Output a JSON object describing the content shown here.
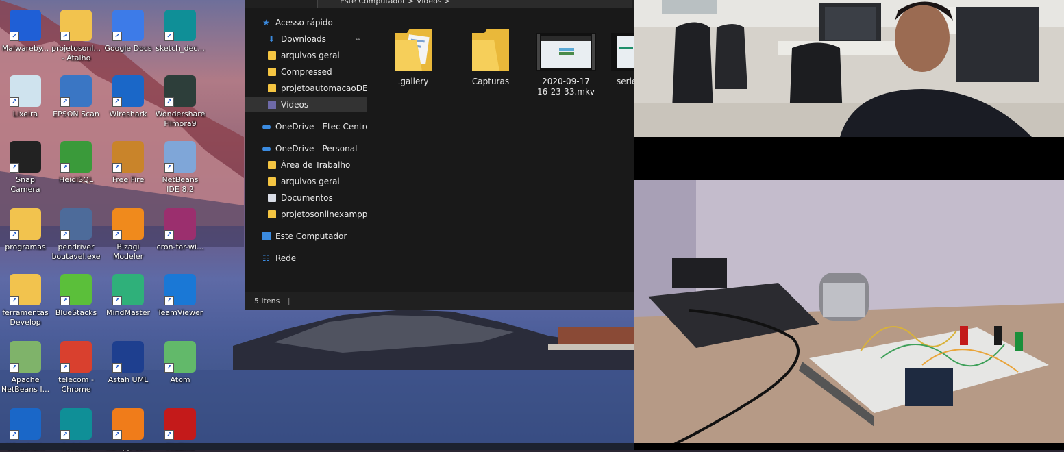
{
  "desktop_icons": [
    {
      "label": "Malwareby...",
      "icon": "malwarebytes-icon",
      "color": "#1f5fd6"
    },
    {
      "label": "projetosonl... - Atalho",
      "icon": "folder-shortcut-icon",
      "color": "#f2c34e"
    },
    {
      "label": "Google Docs",
      "icon": "google-docs-icon",
      "color": "#3d7be8"
    },
    {
      "label": "sketch_dec...",
      "icon": "arduino-sketch-icon",
      "color": "#0f8f97"
    },
    {
      "label": "Lixeira",
      "icon": "recycle-bin-icon",
      "color": "#cfe3ee"
    },
    {
      "label": "EPSON Scan",
      "icon": "scanner-icon",
      "color": "#3a76c4"
    },
    {
      "label": "Wireshark",
      "icon": "wireshark-icon",
      "color": "#1a67c8"
    },
    {
      "label": "Wondershare Filmora9",
      "icon": "filmora-icon",
      "color": "#2d3e3a"
    },
    {
      "label": "Snap Camera",
      "icon": "snap-camera-icon",
      "color": "#222"
    },
    {
      "label": "HeidiSQL",
      "icon": "heidisql-icon",
      "color": "#3a9a3a"
    },
    {
      "label": "Free Fire",
      "icon": "free-fire-icon",
      "color": "#c9842a"
    },
    {
      "label": "NetBeans IDE 8.2",
      "icon": "netbeans-icon",
      "color": "#7fa6d8"
    },
    {
      "label": "programas",
      "icon": "folder-icon",
      "color": "#f2c34e"
    },
    {
      "label": "pendriver boutavel.exe",
      "icon": "pc-installer-icon",
      "color": "#4d6b9a"
    },
    {
      "label": "Bizagi Modeler",
      "icon": "bizagi-icon",
      "color": "#f08a1c"
    },
    {
      "label": "cron-for-wi...",
      "icon": "winrar-icon",
      "color": "#9b2f6e"
    },
    {
      "label": "ferramentas Develop",
      "icon": "folder-tools-icon",
      "color": "#f2c34e"
    },
    {
      "label": "BlueStacks",
      "icon": "bluestacks-icon",
      "color": "#5bbf3a"
    },
    {
      "label": "MindMaster",
      "icon": "mindmaster-icon",
      "color": "#2fb07a"
    },
    {
      "label": "TeamViewer",
      "icon": "teamviewer-icon",
      "color": "#1a78d6"
    },
    {
      "label": "Apache NetBeans I...",
      "icon": "apache-netbeans-icon",
      "color": "#7fb36a"
    },
    {
      "label": "telecom - Chrome",
      "icon": "chrome-icon",
      "color": "#d9402e"
    },
    {
      "label": "Astah UML",
      "icon": "astah-icon",
      "color": "#1e3f8f"
    },
    {
      "label": "Atom",
      "icon": "atom-icon",
      "color": "#62b96a"
    },
    {
      "label": "Wireshark",
      "icon": "wireshark-icon",
      "color": "#1a67c8"
    },
    {
      "label": "Arduino",
      "icon": "arduino-icon",
      "color": "#0f8f97"
    },
    {
      "label": "xampp-co...",
      "icon": "xampp-icon",
      "color": "#f07c1a"
    },
    {
      "label": "FileZilla",
      "icon": "filezilla-icon",
      "color": "#c41a1a"
    }
  ],
  "explorer": {
    "address": "Este Computador  >  Vídeos  >",
    "nav": [
      {
        "label": "Acesso rápido",
        "icon": "star-icon"
      },
      {
        "label": "Downloads",
        "icon": "download-arrow-icon",
        "pinned": true
      },
      {
        "label": "arquivos geral",
        "icon": "folder-icon"
      },
      {
        "label": "Compressed",
        "icon": "folder-icon"
      },
      {
        "label": "projetoautomacaoDEM",
        "icon": "folder-icon"
      },
      {
        "label": "Vídeos",
        "icon": "videos-icon",
        "selected": true
      },
      {
        "label": "OneDrive - Etec Centro P",
        "icon": "onedrive-icon"
      },
      {
        "label": "OneDrive - Personal",
        "icon": "onedrive-icon"
      },
      {
        "label": "Área de Trabalho",
        "icon": "folder-icon"
      },
      {
        "label": "arquivos geral",
        "icon": "folder-icon"
      },
      {
        "label": "Documentos",
        "icon": "documents-icon"
      },
      {
        "label": "projetosonlinexampp",
        "icon": "folder-icon"
      },
      {
        "label": "Este Computador",
        "icon": "computer-icon"
      },
      {
        "label": "Rede",
        "icon": "network-icon"
      }
    ],
    "files": [
      {
        "name": ".gallery",
        "type": "folder"
      },
      {
        "name": "Capturas",
        "type": "folder"
      },
      {
        "name": "2020-09-17 16-23-33.mkv",
        "type": "video"
      },
      {
        "name": "serie",
        "type": "video"
      }
    ],
    "status": "5 itens",
    "colors": {
      "bg": "#191919",
      "folder": "#f4c542",
      "selection": "#333333"
    }
  }
}
